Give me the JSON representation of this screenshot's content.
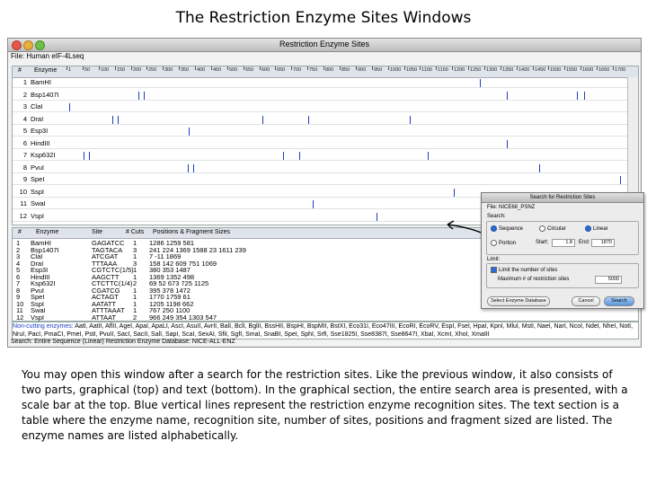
{
  "slide_title": "The Restriction Enzyme Sites Windows",
  "window": {
    "title": "Restriction Enzyme Sites",
    "file_label": "File: Human eIF-4Lseq"
  },
  "graph": {
    "header_number": "#",
    "header_enzyme": "Enzyme",
    "scale_ticks": [
      "1",
      "50",
      "100",
      "150",
      "200",
      "250",
      "300",
      "350",
      "400",
      "450",
      "500",
      "550",
      "600",
      "650",
      "700",
      "750",
      "800",
      "850",
      "900",
      "950",
      "1000",
      "1050",
      "1100",
      "1150",
      "1200",
      "1250",
      "1300",
      "1350",
      "1400",
      "1450",
      "1500",
      "1550",
      "1600",
      "1650",
      "1700"
    ],
    "scale_max": 1700,
    "rows": [
      {
        "num": "1",
        "name": "BamHI",
        "sites": [
          1286
        ]
      },
      {
        "num": "2",
        "name": "Bsp1407I",
        "sites": [
          241,
          224,
          1369,
          1588,
          1611
        ]
      },
      {
        "num": "3",
        "name": "ClaI",
        "sites": [
          7
        ]
      },
      {
        "num": "4",
        "name": "DraI",
        "sites": [
          158,
          142,
          609,
          751,
          1069
        ]
      },
      {
        "num": "5",
        "name": "Esp3I",
        "sites": [
          380
        ]
      },
      {
        "num": "6",
        "name": "HindIII",
        "sites": [
          1369
        ]
      },
      {
        "num": "7",
        "name": "Ksp632I",
        "sites": [
          69,
          52,
          673,
          725,
          1125
        ]
      },
      {
        "num": "8",
        "name": "PvuI",
        "sites": [
          395,
          378,
          1472
        ]
      },
      {
        "num": "9",
        "name": "SpeI",
        "sites": [
          1770
        ]
      },
      {
        "num": "10",
        "name": "SspI",
        "sites": [
          1205
        ]
      },
      {
        "num": "11",
        "name": "SwaI",
        "sites": [
          767
        ]
      },
      {
        "num": "12",
        "name": "VspI",
        "sites": [
          966
        ]
      }
    ]
  },
  "table": {
    "headers": {
      "num": "#",
      "enzyme": "Enzyme",
      "site": "Site",
      "cuts": "# Cuts",
      "positions": "Positions & Fragment Sizes"
    },
    "rows": [
      {
        "num": "1",
        "enzyme": "BamHI",
        "site": "GAGATCC",
        "cuts": "1",
        "positions": "1286   1259   581"
      },
      {
        "num": "2",
        "enzyme": "Bsp1407I",
        "site": "TAGTACA",
        "cuts": "3",
        "positions": "241   224   1369   1588     23   1611   239"
      },
      {
        "num": "3",
        "enzyme": "ClaI",
        "site": "ATCGAT",
        "cuts": "1",
        "positions": "7   -11   1869"
      },
      {
        "num": "4",
        "enzyme": "DraI",
        "site": "TTTAAA",
        "cuts": "3",
        "positions": "158   142   609   751   1069"
      },
      {
        "num": "5",
        "enzyme": "Esp3I",
        "site": "CGTCTC(1/5)",
        "cuts": "1",
        "positions": "380   353   1487"
      },
      {
        "num": "6",
        "enzyme": "HindIII",
        "site": "AAGCTT",
        "cuts": "1",
        "positions": "1369   1352   498"
      },
      {
        "num": "7",
        "enzyme": "Ksp632I",
        "site": "CTCTTC(1/4)",
        "cuts": "2",
        "positions": "69   52   673   725   1125"
      },
      {
        "num": "8",
        "enzyme": "PvuI",
        "site": "CGATCG",
        "cuts": "1",
        "positions": "395   378   1472"
      },
      {
        "num": "9",
        "enzyme": "SpeI",
        "site": "ACTAGT",
        "cuts": "1",
        "positions": "1770   1759   61"
      },
      {
        "num": "10",
        "enzyme": "SspI",
        "site": "AATATT",
        "cuts": "1",
        "positions": "1205   1198   662"
      },
      {
        "num": "11",
        "enzyme": "SwaI",
        "site": "ATTTAAAT",
        "cuts": "1",
        "positions": "767   250   1100"
      },
      {
        "num": "12",
        "enzyme": "VspI",
        "site": "ATTAAT",
        "cuts": "2",
        "positions": "966   249   354   1303   547"
      }
    ]
  },
  "noncutting": {
    "label": "Non-cutting enzymes:",
    "text": "AatI, AatII, AflII, AgeI, ApaI, ApaLI, AscI, AsuII, AvrII, BalI, BclI, BglII, BssHII, BspHI, BspMII, BstXI, Eco31I, Eco47III, EcoRI, EcoRV, EspI, FseI, HpaI, KpnI, MluI, MstI, NaeI, NarI, NcoI, NdeI, NheI, NotI, NruI, PacI, PmaCI, PmeI, PstI, PvuII, SacI, SacII, SalI, SapI, ScaI, SexAI, SfiI, SgfI, SmaI, SnaBI, SpeI, SphI, SrfI, Sse1825I, Sse8387I, Sse8647I, XbaI, XcmI, XhoI, XmaIII"
  },
  "status_text": "Search: Entire Sequence (Linear)    Restriction Enzyme Database: NICE-ALL-ENZ",
  "dialog": {
    "title": "Search for Restriction Sites",
    "file": "File: NICE68_PSNZ",
    "search_label": "Search:",
    "opt_sequence": "Sequence",
    "opt_circular": "Circular",
    "opt_linear": "Linear",
    "opt_portion": "Portion",
    "start_label": "Start:",
    "start_value": "1.8",
    "end_label": "End:",
    "end_value": "1870",
    "limit_label": "Limit:",
    "limit_check_label": "Limit the number of sites",
    "max_label": "Maximum # of restriction sites",
    "max_value": "5000",
    "btn_select": "Select Enzyme Database",
    "btn_cancel": "Cancel",
    "btn_search": "Search"
  },
  "caption": "You may open this window after a search for the restriction sites. Like the previous window, it also consists of two parts, graphical (top) and text (bottom). In the graphical section, the entire search area is presented, with a scale bar at the top. Blue vertical lines represent the restriction enzyme recognition sites. The text section is a table where the enzyme name, recognition site, number of sites, positions and fragment sized are listed. The enzyme names are listed alphabetically.",
  "colors": {
    "site_line": "#1a3fc4",
    "header_bg": "#dfe3ea",
    "primary_button": "#5b96e0"
  }
}
